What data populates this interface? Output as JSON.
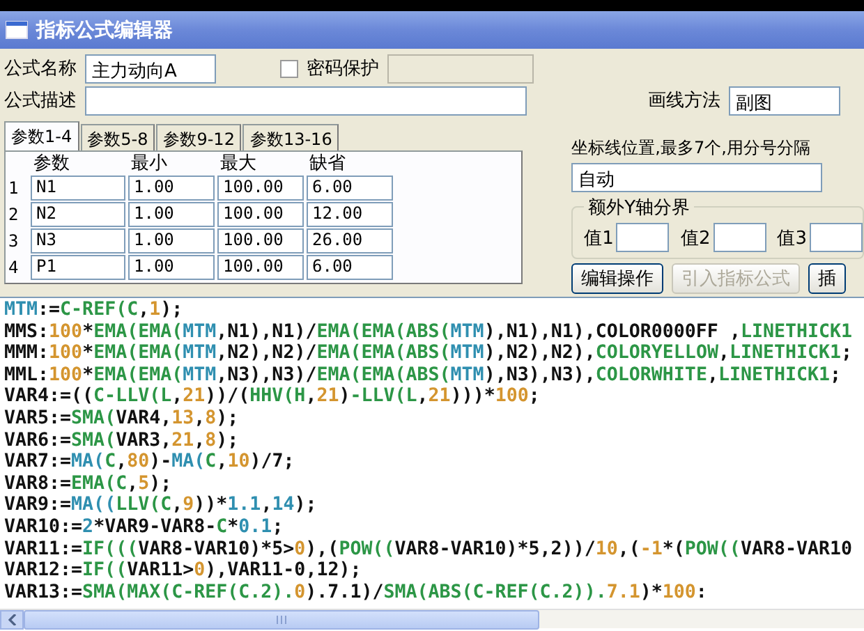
{
  "window": {
    "title": "指标公式编辑器"
  },
  "formula_name": {
    "label": "公式名称",
    "value": "主力动向A"
  },
  "password": {
    "label": "密码保护",
    "checked": false
  },
  "formula_desc": {
    "label": "公式描述"
  },
  "draw_method": {
    "label": "画线方法",
    "value": "副图"
  },
  "tabs": [
    {
      "label": "参数1-4",
      "selected": true
    },
    {
      "label": "参数5-8",
      "selected": false
    },
    {
      "label": "参数9-12",
      "selected": false
    },
    {
      "label": "参数13-16",
      "selected": false
    }
  ],
  "params": {
    "columns": [
      "参数",
      "最小",
      "最大",
      "缺省"
    ],
    "rows": [
      {
        "index": "1",
        "values": [
          "N1",
          "1.00",
          "100.00",
          "6.00"
        ]
      },
      {
        "index": "2",
        "values": [
          "N2",
          "1.00",
          "100.00",
          "12.00"
        ]
      },
      {
        "index": "3",
        "values": [
          "N3",
          "1.00",
          "100.00",
          "26.00"
        ]
      },
      {
        "index": "4",
        "values": [
          "P1",
          "1.00",
          "100.00",
          "6.00"
        ]
      }
    ]
  },
  "axis_lines": {
    "label": "坐标线位置,最多7个,用分号分隔",
    "value": "自动"
  },
  "extra_y": {
    "title": "额外Y轴分界",
    "fields": [
      {
        "label": "值1"
      },
      {
        "label": "值2"
      },
      {
        "label": "值3"
      }
    ]
  },
  "buttons": [
    {
      "label": "编辑操作",
      "disabled": false
    },
    {
      "label": "引入指标公式",
      "disabled": true
    },
    {
      "label": "插",
      "disabled": false
    }
  ],
  "code_lines": [
    [
      {
        "kind": "var",
        "text": "MTM"
      },
      {
        "kind": "plain",
        "text": ":="
      },
      {
        "kind": "func",
        "text": "C-REF(C"
      },
      {
        "kind": "plain",
        "text": ","
      },
      {
        "kind": "num",
        "text": "1"
      },
      {
        "kind": "plain",
        "text": ");"
      }
    ],
    [
      {
        "kind": "plain",
        "text": "MMS:"
      },
      {
        "kind": "num",
        "text": "100"
      },
      {
        "kind": "plain",
        "text": "*"
      },
      {
        "kind": "func",
        "text": "EMA(EMA("
      },
      {
        "kind": "var",
        "text": "MTM"
      },
      {
        "kind": "plain",
        "text": ",N1),N1)/"
      },
      {
        "kind": "func",
        "text": "EMA(EMA(ABS("
      },
      {
        "kind": "var",
        "text": "MTM"
      },
      {
        "kind": "plain",
        "text": "),N1),N1),COLOR0000FF ,"
      },
      {
        "kind": "func",
        "text": "LINETHICK1"
      }
    ],
    [
      {
        "kind": "plain",
        "text": "MMM:"
      },
      {
        "kind": "num",
        "text": "100"
      },
      {
        "kind": "plain",
        "text": "*"
      },
      {
        "kind": "func",
        "text": "EMA(EMA("
      },
      {
        "kind": "var",
        "text": "MTM"
      },
      {
        "kind": "plain",
        "text": ",N2),N2)/"
      },
      {
        "kind": "func",
        "text": "EMA(EMA(ABS("
      },
      {
        "kind": "var",
        "text": "MTM"
      },
      {
        "kind": "plain",
        "text": "),N2),N2),"
      },
      {
        "kind": "func",
        "text": "COLORYELLOW"
      },
      {
        "kind": "plain",
        "text": ","
      },
      {
        "kind": "func",
        "text": "LINETHICK1"
      },
      {
        "kind": "plain",
        "text": ";"
      }
    ],
    [
      {
        "kind": "plain",
        "text": "MML:"
      },
      {
        "kind": "num",
        "text": "100"
      },
      {
        "kind": "plain",
        "text": "*"
      },
      {
        "kind": "func",
        "text": "EMA(EMA("
      },
      {
        "kind": "var",
        "text": "MTM"
      },
      {
        "kind": "plain",
        "text": ",N3),N3)/"
      },
      {
        "kind": "func",
        "text": "EMA(EMA(ABS("
      },
      {
        "kind": "var",
        "text": "MTM"
      },
      {
        "kind": "plain",
        "text": "),N3),N3),"
      },
      {
        "kind": "func",
        "text": "COLORWHITE"
      },
      {
        "kind": "plain",
        "text": ","
      },
      {
        "kind": "func",
        "text": "LINETHICK1"
      },
      {
        "kind": "plain",
        "text": ";"
      }
    ],
    [
      {
        "kind": "plain",
        "text": "VAR4:=(("
      },
      {
        "kind": "func",
        "text": "C-LLV(L"
      },
      {
        "kind": "plain",
        "text": ","
      },
      {
        "kind": "num",
        "text": "21"
      },
      {
        "kind": "plain",
        "text": "))/("
      },
      {
        "kind": "func",
        "text": "HHV(H"
      },
      {
        "kind": "plain",
        "text": ","
      },
      {
        "kind": "num",
        "text": "21"
      },
      {
        "kind": "plain",
        "text": ")"
      },
      {
        "kind": "func",
        "text": "-LLV(L"
      },
      {
        "kind": "plain",
        "text": ","
      },
      {
        "kind": "num",
        "text": "21"
      },
      {
        "kind": "plain",
        "text": ")))*"
      },
      {
        "kind": "num",
        "text": "100"
      },
      {
        "kind": "plain",
        "text": ";"
      }
    ],
    [
      {
        "kind": "plain",
        "text": "VAR5:="
      },
      {
        "kind": "func",
        "text": "SMA("
      },
      {
        "kind": "plain",
        "text": "VAR4,"
      },
      {
        "kind": "num",
        "text": "13"
      },
      {
        "kind": "plain",
        "text": ","
      },
      {
        "kind": "num",
        "text": "8"
      },
      {
        "kind": "plain",
        "text": ");"
      }
    ],
    [
      {
        "kind": "plain",
        "text": "VAR6:="
      },
      {
        "kind": "func",
        "text": "SMA("
      },
      {
        "kind": "plain",
        "text": "VAR3,"
      },
      {
        "kind": "num",
        "text": "21"
      },
      {
        "kind": "plain",
        "text": ","
      },
      {
        "kind": "num",
        "text": "8"
      },
      {
        "kind": "plain",
        "text": ");"
      }
    ],
    [
      {
        "kind": "plain",
        "text": "VAR7:="
      },
      {
        "kind": "var",
        "text": "MA("
      },
      {
        "kind": "func",
        "text": "C"
      },
      {
        "kind": "plain",
        "text": ","
      },
      {
        "kind": "num",
        "text": "80"
      },
      {
        "kind": "plain",
        "text": ")-"
      },
      {
        "kind": "var",
        "text": "MA("
      },
      {
        "kind": "func",
        "text": "C"
      },
      {
        "kind": "plain",
        "text": ","
      },
      {
        "kind": "num",
        "text": "10"
      },
      {
        "kind": "plain",
        "text": ")/7;"
      }
    ],
    [
      {
        "kind": "plain",
        "text": "VAR8:="
      },
      {
        "kind": "func",
        "text": "EMA(C"
      },
      {
        "kind": "plain",
        "text": ","
      },
      {
        "kind": "num",
        "text": "5"
      },
      {
        "kind": "plain",
        "text": ");"
      }
    ],
    [
      {
        "kind": "plain",
        "text": "VAR9:="
      },
      {
        "kind": "var",
        "text": "MA(("
      },
      {
        "kind": "func",
        "text": "LLV(C"
      },
      {
        "kind": "plain",
        "text": ","
      },
      {
        "kind": "num",
        "text": "9"
      },
      {
        "kind": "plain",
        "text": "))*"
      },
      {
        "kind": "var",
        "text": "1.1"
      },
      {
        "kind": "plain",
        "text": ","
      },
      {
        "kind": "var",
        "text": "14"
      },
      {
        "kind": "plain",
        "text": ");"
      }
    ],
    [
      {
        "kind": "plain",
        "text": "VAR10:="
      },
      {
        "kind": "var",
        "text": "2"
      },
      {
        "kind": "plain",
        "text": "*VAR9-VAR8-"
      },
      {
        "kind": "func",
        "text": "C"
      },
      {
        "kind": "plain",
        "text": "*"
      },
      {
        "kind": "var",
        "text": "0.1"
      },
      {
        "kind": "plain",
        "text": ";"
      }
    ],
    [
      {
        "kind": "plain",
        "text": "VAR11:="
      },
      {
        "kind": "func",
        "text": "IF((("
      },
      {
        "kind": "plain",
        "text": "VAR8-VAR10)*5>"
      },
      {
        "kind": "num",
        "text": "0"
      },
      {
        "kind": "plain",
        "text": "),("
      },
      {
        "kind": "func",
        "text": "POW(("
      },
      {
        "kind": "plain",
        "text": "VAR8-VAR10)*5,2))/"
      },
      {
        "kind": "num",
        "text": "10"
      },
      {
        "kind": "plain",
        "text": ",("
      },
      {
        "kind": "num",
        "text": "-1"
      },
      {
        "kind": "plain",
        "text": "*("
      },
      {
        "kind": "func",
        "text": "POW(("
      },
      {
        "kind": "plain",
        "text": "VAR8-VAR10"
      }
    ],
    [
      {
        "kind": "plain",
        "text": "VAR12:="
      },
      {
        "kind": "func",
        "text": "IF(("
      },
      {
        "kind": "plain",
        "text": "VAR11>"
      },
      {
        "kind": "num",
        "text": "0"
      },
      {
        "kind": "plain",
        "text": "),VAR11-0,12);"
      }
    ],
    [
      {
        "kind": "plain",
        "text": "VAR13:="
      },
      {
        "kind": "func",
        "text": "SMA(MAX(C-REF(C.2)."
      },
      {
        "kind": "num",
        "text": "0"
      },
      {
        "kind": "plain",
        "text": ").7.1)/"
      },
      {
        "kind": "func",
        "text": "SMA(ABS(C-REF(C.2))."
      },
      {
        "kind": "num",
        "text": "7.1"
      },
      {
        "kind": "plain",
        "text": ")*"
      },
      {
        "kind": "num",
        "text": "100"
      },
      {
        "kind": "plain",
        "text": ":"
      }
    ]
  ]
}
